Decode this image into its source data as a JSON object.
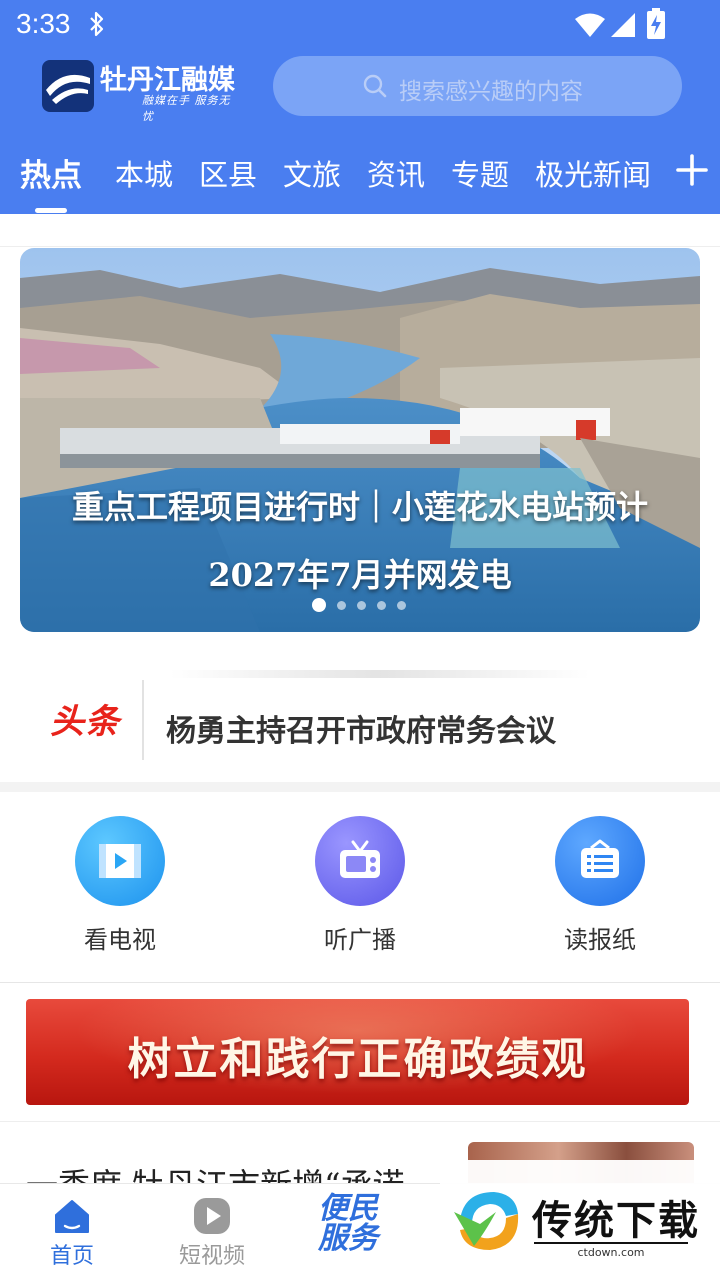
{
  "status_bar": {
    "time": "3:33"
  },
  "header": {
    "logo_name": "牡丹江融媒",
    "logo_slogan": "融媒在手 服务无忧",
    "search_placeholder": "搜索感兴趣的内容"
  },
  "tabs": [
    {
      "label": "热点",
      "active": true
    },
    {
      "label": "本城"
    },
    {
      "label": "区县"
    },
    {
      "label": "文旅"
    },
    {
      "label": "资讯"
    },
    {
      "label": "专题"
    },
    {
      "label": "极光新闻"
    }
  ],
  "banner": {
    "caption_line1": "重点工程项目进行时｜小莲花水电站预计",
    "caption_line2": "2027年7月并网发电",
    "slide_count": 5,
    "active_slide": 1
  },
  "headline": {
    "tag": "头条",
    "text": "杨勇主持召开市政府常务会议",
    "tag_color": "#e8231b"
  },
  "quick_entries": [
    {
      "label": "看电视",
      "icon": "video-icon",
      "color": "#2aa6f5"
    },
    {
      "label": "听广播",
      "icon": "radio-icon",
      "color": "#6f6cf2"
    },
    {
      "label": "读报纸",
      "icon": "newspaper-icon",
      "color": "#2f86f3"
    }
  ],
  "promo": {
    "text": "树立和践行正确政绩观"
  },
  "next_article": {
    "title": "一季度 牡丹江市新增“承诺"
  },
  "bottom_nav": {
    "items": [
      {
        "label": "首页",
        "icon": "home-icon",
        "active": true
      },
      {
        "label": "短视频",
        "icon": "play-icon"
      },
      {
        "label": "便民服务",
        "icon": "service-text-icon"
      }
    ]
  },
  "watermark": {
    "text": "传统下载",
    "url": "ctdown.com"
  },
  "colors": {
    "brand_blue": "#4a7ef0",
    "active_nav": "#2f6fdc",
    "promo_red": "#d42a1e"
  }
}
